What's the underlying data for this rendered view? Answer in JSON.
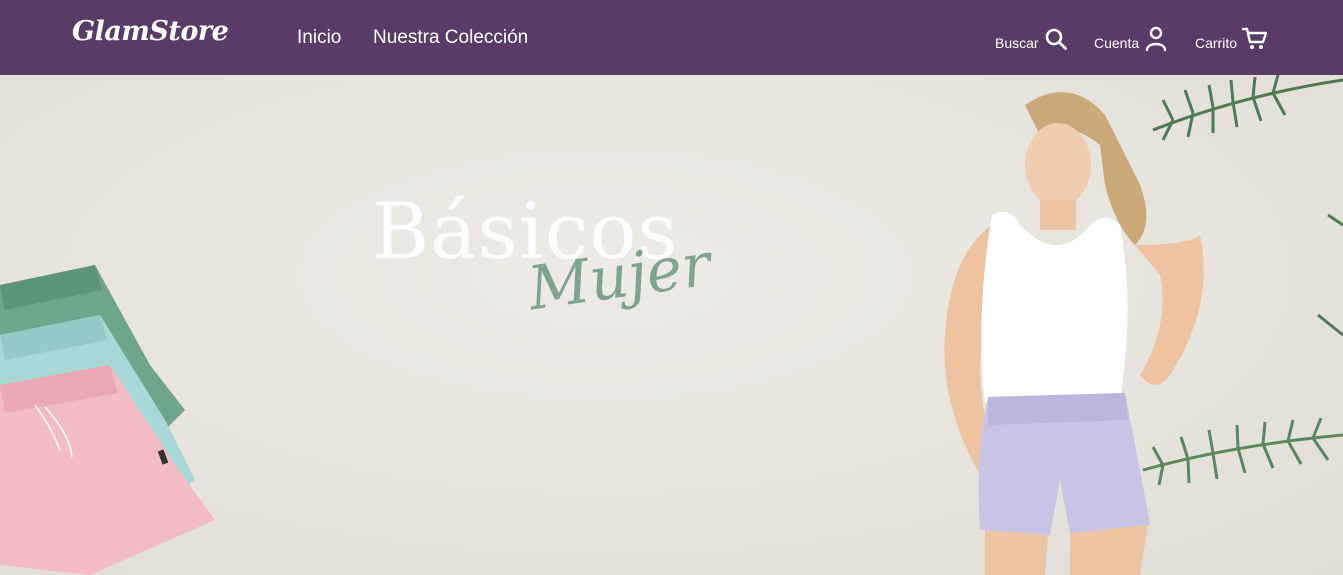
{
  "brand": {
    "logo_text": "GlamStore"
  },
  "nav": {
    "links": [
      {
        "label": "Inicio"
      },
      {
        "label": "Nuestra Colección"
      }
    ],
    "utilities": {
      "search_label": "Buscar",
      "account_label": "Cuenta",
      "cart_label": "Carrito"
    },
    "icons": {
      "search": "search-icon",
      "account": "user-icon",
      "cart": "cart-icon"
    }
  },
  "hero": {
    "title": "Básicos",
    "script": "Mujer"
  },
  "colors": {
    "nav_background": "#583b67",
    "hero_background": "#ebe8e2",
    "script_accent": "#7fa38b",
    "title_text": "#ffffff"
  }
}
